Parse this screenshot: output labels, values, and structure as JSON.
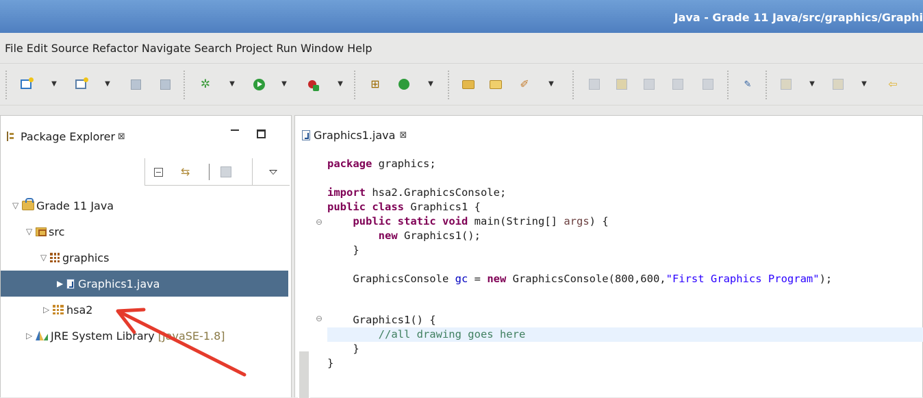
{
  "window": {
    "title": "Java - Grade 11 Java/src/graphics/Graphi"
  },
  "menubar": {
    "items": [
      "File",
      "Edit",
      "Source",
      "Refactor",
      "Navigate",
      "Search",
      "Project",
      "Run",
      "Window",
      "Help"
    ]
  },
  "toolbar": {
    "icons": [
      "new-icon",
      "new-menu-arrow",
      "new-class-icon",
      "new-class-arrow",
      "save-icon",
      "save-all-icon",
      "debug-icon",
      "debug-arrow",
      "run-icon",
      "run-arrow",
      "external-tools-icon",
      "external-tools-arrow",
      "new-java-class-icon",
      "new-package-icon",
      "new-package-arrow",
      "open-type-icon",
      "open-task-icon",
      "search-icon",
      "search-arrow",
      "annotation-icon",
      "highlighter-icon",
      "toggle-comment-icon",
      "block-select-icon",
      "show-whitespace-icon",
      "pin-editor-icon",
      "next-annotation-icon",
      "next-annotation-arrow",
      "previous-annotation-icon",
      "previous-annotation-arrow",
      "back-icon"
    ]
  },
  "package_explorer": {
    "tab_title": "Package Explorer",
    "tree": [
      {
        "label": "Grade 11 Java",
        "expanded": true,
        "type": "project"
      },
      {
        "label": "src",
        "expanded": true,
        "type": "source-folder"
      },
      {
        "label": "graphics",
        "expanded": true,
        "type": "package"
      },
      {
        "label": "Graphics1.java",
        "expanded": false,
        "type": "java-file",
        "selected": true
      },
      {
        "label": "hsa2",
        "expanded": false,
        "type": "package"
      },
      {
        "label": "JRE System Library",
        "suffix": "[JavaSE-1.8]",
        "expanded": false,
        "type": "library"
      }
    ]
  },
  "editor": {
    "tab_title": "Graphics1.java",
    "code": {
      "l1_kw": "package",
      "l1_rest": " graphics;",
      "l3_kw": "import",
      "l3_rest": " hsa2.GraphicsConsole;",
      "l4_kw1": "public",
      "l4_sp": " ",
      "l4_kw2": "class",
      "l4_rest": " Graphics1 {",
      "l5_indent": "    ",
      "l5_kw1": "public",
      "l5_kw2": "static",
      "l5_kw3": "void",
      "l5_rest": " main(String[] ",
      "l5_param": "args",
      "l5_end": ") {",
      "l6_indent": "        ",
      "l6_kw": "new",
      "l6_rest": " Graphics1();",
      "l7": "    }",
      "l9_start": "    GraphicsConsole ",
      "l9_field": "gc",
      "l9_mid1": " = ",
      "l9_kw": "new",
      "l9_mid2": " GraphicsConsole(800,600,",
      "l9_str": "\"First Graphics Program\"",
      "l9_end": ");",
      "l11": "    Graphics1() {",
      "l12_indent": "        ",
      "l12_comment": "//all drawing goes here",
      "l13": "    }",
      "l14": "}"
    }
  },
  "colors": {
    "title_bar": "#5a8ac8",
    "selection": "#4d6d8c",
    "keyword": "#7f0055",
    "string": "#2a00ff",
    "comment": "#3f7f5f",
    "field": "#0000c0",
    "annotation_arrow": "#e53b2c"
  }
}
